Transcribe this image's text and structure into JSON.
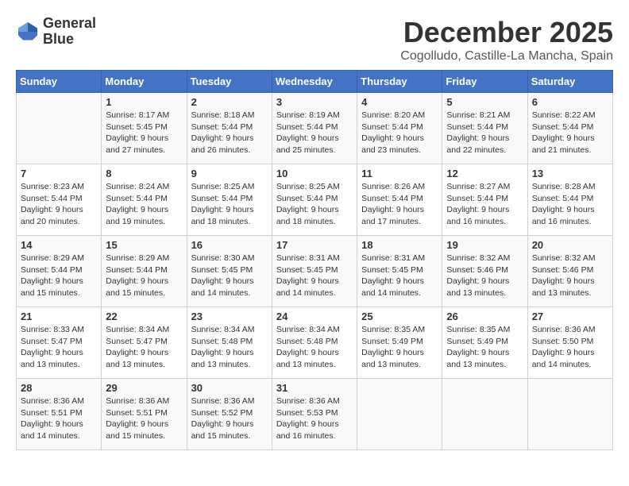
{
  "header": {
    "logo_line1": "General",
    "logo_line2": "Blue",
    "month": "December 2025",
    "location": "Cogolludo, Castille-La Mancha, Spain"
  },
  "weekdays": [
    "Sunday",
    "Monday",
    "Tuesday",
    "Wednesday",
    "Thursday",
    "Friday",
    "Saturday"
  ],
  "weeks": [
    [
      {
        "day": "",
        "sunrise": "",
        "sunset": "",
        "daylight": ""
      },
      {
        "day": "1",
        "sunrise": "Sunrise: 8:17 AM",
        "sunset": "Sunset: 5:45 PM",
        "daylight": "Daylight: 9 hours and 27 minutes."
      },
      {
        "day": "2",
        "sunrise": "Sunrise: 8:18 AM",
        "sunset": "Sunset: 5:44 PM",
        "daylight": "Daylight: 9 hours and 26 minutes."
      },
      {
        "day": "3",
        "sunrise": "Sunrise: 8:19 AM",
        "sunset": "Sunset: 5:44 PM",
        "daylight": "Daylight: 9 hours and 25 minutes."
      },
      {
        "day": "4",
        "sunrise": "Sunrise: 8:20 AM",
        "sunset": "Sunset: 5:44 PM",
        "daylight": "Daylight: 9 hours and 23 minutes."
      },
      {
        "day": "5",
        "sunrise": "Sunrise: 8:21 AM",
        "sunset": "Sunset: 5:44 PM",
        "daylight": "Daylight: 9 hours and 22 minutes."
      },
      {
        "day": "6",
        "sunrise": "Sunrise: 8:22 AM",
        "sunset": "Sunset: 5:44 PM",
        "daylight": "Daylight: 9 hours and 21 minutes."
      }
    ],
    [
      {
        "day": "7",
        "sunrise": "Sunrise: 8:23 AM",
        "sunset": "Sunset: 5:44 PM",
        "daylight": "Daylight: 9 hours and 20 minutes."
      },
      {
        "day": "8",
        "sunrise": "Sunrise: 8:24 AM",
        "sunset": "Sunset: 5:44 PM",
        "daylight": "Daylight: 9 hours and 19 minutes."
      },
      {
        "day": "9",
        "sunrise": "Sunrise: 8:25 AM",
        "sunset": "Sunset: 5:44 PM",
        "daylight": "Daylight: 9 hours and 18 minutes."
      },
      {
        "day": "10",
        "sunrise": "Sunrise: 8:25 AM",
        "sunset": "Sunset: 5:44 PM",
        "daylight": "Daylight: 9 hours and 18 minutes."
      },
      {
        "day": "11",
        "sunrise": "Sunrise: 8:26 AM",
        "sunset": "Sunset: 5:44 PM",
        "daylight": "Daylight: 9 hours and 17 minutes."
      },
      {
        "day": "12",
        "sunrise": "Sunrise: 8:27 AM",
        "sunset": "Sunset: 5:44 PM",
        "daylight": "Daylight: 9 hours and 16 minutes."
      },
      {
        "day": "13",
        "sunrise": "Sunrise: 8:28 AM",
        "sunset": "Sunset: 5:44 PM",
        "daylight": "Daylight: 9 hours and 16 minutes."
      }
    ],
    [
      {
        "day": "14",
        "sunrise": "Sunrise: 8:29 AM",
        "sunset": "Sunset: 5:44 PM",
        "daylight": "Daylight: 9 hours and 15 minutes."
      },
      {
        "day": "15",
        "sunrise": "Sunrise: 8:29 AM",
        "sunset": "Sunset: 5:44 PM",
        "daylight": "Daylight: 9 hours and 15 minutes."
      },
      {
        "day": "16",
        "sunrise": "Sunrise: 8:30 AM",
        "sunset": "Sunset: 5:45 PM",
        "daylight": "Daylight: 9 hours and 14 minutes."
      },
      {
        "day": "17",
        "sunrise": "Sunrise: 8:31 AM",
        "sunset": "Sunset: 5:45 PM",
        "daylight": "Daylight: 9 hours and 14 minutes."
      },
      {
        "day": "18",
        "sunrise": "Sunrise: 8:31 AM",
        "sunset": "Sunset: 5:45 PM",
        "daylight": "Daylight: 9 hours and 14 minutes."
      },
      {
        "day": "19",
        "sunrise": "Sunrise: 8:32 AM",
        "sunset": "Sunset: 5:46 PM",
        "daylight": "Daylight: 9 hours and 13 minutes."
      },
      {
        "day": "20",
        "sunrise": "Sunrise: 8:32 AM",
        "sunset": "Sunset: 5:46 PM",
        "daylight": "Daylight: 9 hours and 13 minutes."
      }
    ],
    [
      {
        "day": "21",
        "sunrise": "Sunrise: 8:33 AM",
        "sunset": "Sunset: 5:47 PM",
        "daylight": "Daylight: 9 hours and 13 minutes."
      },
      {
        "day": "22",
        "sunrise": "Sunrise: 8:34 AM",
        "sunset": "Sunset: 5:47 PM",
        "daylight": "Daylight: 9 hours and 13 minutes."
      },
      {
        "day": "23",
        "sunrise": "Sunrise: 8:34 AM",
        "sunset": "Sunset: 5:48 PM",
        "daylight": "Daylight: 9 hours and 13 minutes."
      },
      {
        "day": "24",
        "sunrise": "Sunrise: 8:34 AM",
        "sunset": "Sunset: 5:48 PM",
        "daylight": "Daylight: 9 hours and 13 minutes."
      },
      {
        "day": "25",
        "sunrise": "Sunrise: 8:35 AM",
        "sunset": "Sunset: 5:49 PM",
        "daylight": "Daylight: 9 hours and 13 minutes."
      },
      {
        "day": "26",
        "sunrise": "Sunrise: 8:35 AM",
        "sunset": "Sunset: 5:49 PM",
        "daylight": "Daylight: 9 hours and 13 minutes."
      },
      {
        "day": "27",
        "sunrise": "Sunrise: 8:36 AM",
        "sunset": "Sunset: 5:50 PM",
        "daylight": "Daylight: 9 hours and 14 minutes."
      }
    ],
    [
      {
        "day": "28",
        "sunrise": "Sunrise: 8:36 AM",
        "sunset": "Sunset: 5:51 PM",
        "daylight": "Daylight: 9 hours and 14 minutes."
      },
      {
        "day": "29",
        "sunrise": "Sunrise: 8:36 AM",
        "sunset": "Sunset: 5:51 PM",
        "daylight": "Daylight: 9 hours and 15 minutes."
      },
      {
        "day": "30",
        "sunrise": "Sunrise: 8:36 AM",
        "sunset": "Sunset: 5:52 PM",
        "daylight": "Daylight: 9 hours and 15 minutes."
      },
      {
        "day": "31",
        "sunrise": "Sunrise: 8:36 AM",
        "sunset": "Sunset: 5:53 PM",
        "daylight": "Daylight: 9 hours and 16 minutes."
      },
      {
        "day": "",
        "sunrise": "",
        "sunset": "",
        "daylight": ""
      },
      {
        "day": "",
        "sunrise": "",
        "sunset": "",
        "daylight": ""
      },
      {
        "day": "",
        "sunrise": "",
        "sunset": "",
        "daylight": ""
      }
    ]
  ]
}
